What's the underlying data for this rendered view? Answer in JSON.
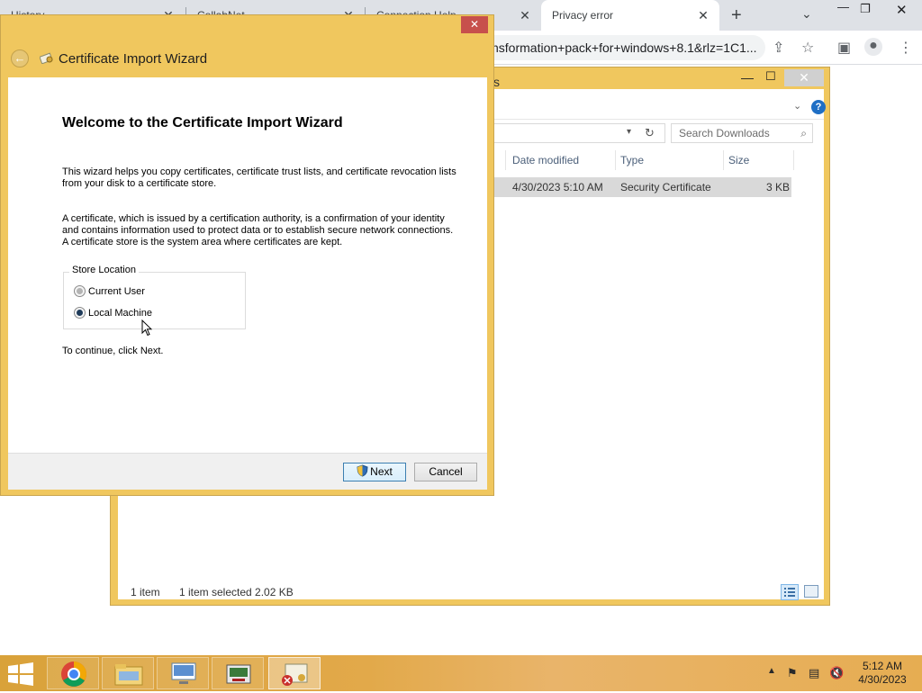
{
  "browser": {
    "tabs": [
      {
        "title": "History",
        "active": false
      },
      {
        "title": "CollabNet",
        "active": false
      },
      {
        "title": "Connection Help",
        "active": false
      },
      {
        "title": "Privacy error",
        "active": true
      }
    ],
    "new_tab_icon": "plus-icon",
    "url_fragment": "nsformation+pack+for+windows+8.1&rlz=1C1..."
  },
  "explorer": {
    "title_fragment": "s",
    "search_placeholder": "Search Downloads",
    "columns": [
      "Date modified",
      "Type",
      "Size"
    ],
    "file": {
      "date_modified": "4/30/2023 5:10 AM",
      "type": "Security Certificate",
      "size": "3 KB"
    },
    "status_count": "1 item",
    "status_selected": "1 item selected  2.02 KB"
  },
  "wizard": {
    "window_title": "Certificate Import Wizard",
    "heading": "Welcome to the Certificate Import Wizard",
    "paragraph1": "This wizard helps you copy certificates, certificate trust lists, and certificate revocation lists from your disk to a certificate store.",
    "paragraph2": "A certificate, which is issued by a certification authority, is a confirmation of your identity and contains information used to protect data or to establish secure network connections. A certificate store is the system area where certificates are kept.",
    "store_location_label": "Store Location",
    "options": [
      {
        "label": "Current User",
        "selected": false
      },
      {
        "label": "Local Machine",
        "selected": true
      }
    ],
    "continue_text": "To continue, click Next.",
    "next_label": "Next",
    "cancel_label": "Cancel",
    "close_label": "✕"
  },
  "taskbar": {
    "time": "5:12 AM",
    "date": "4/30/2023",
    "apps": [
      "chrome-icon",
      "file-explorer-icon",
      "remote-desktop-icon",
      "network-console-icon",
      "certificate-icon"
    ]
  },
  "colors": {
    "window_frame": "#f0c75e",
    "taskbar": "#e2a94a",
    "close_button": "#c7504c"
  }
}
